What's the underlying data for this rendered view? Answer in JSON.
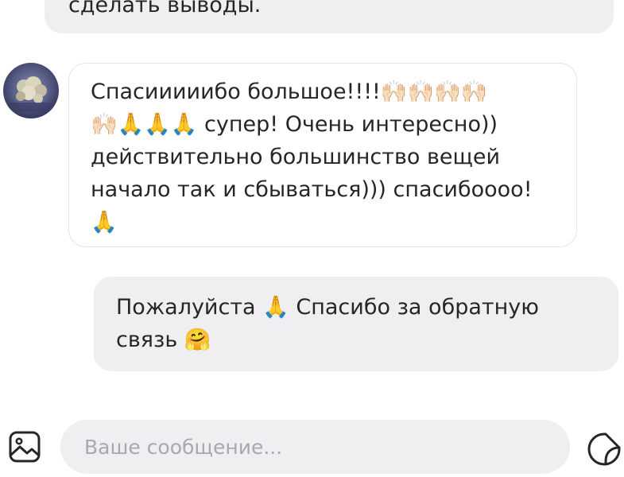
{
  "messages": {
    "previous_partial": "сделать выводы.",
    "incoming": {
      "text": "Спасииииибо большое!!!!🙌🏻🙌🏻🙌🏻🙌🏻\n🙌🏻🙏🙏🙏 супер! Очень интересно))\nдействительно большинство вещей\nначало так и сбываться))) спасибоооо!\n🙏"
    },
    "outgoing": {
      "text": "Пожалуйста 🙏 Спасибо за обратную\nсвязь 🤗"
    }
  },
  "composer": {
    "placeholder": "Ваше сообщение...",
    "value": "",
    "left_icon": "gallery-icon",
    "right_icon": "sticker-icon"
  },
  "theme": {
    "bubble_gray": "#efeff1",
    "bubble_border": "#e4e4e8",
    "text_color": "#262626",
    "placeholder_color": "#a8a8ad"
  }
}
